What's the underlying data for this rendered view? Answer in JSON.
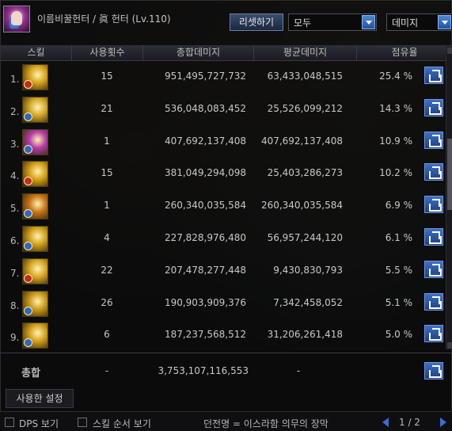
{
  "header": {
    "character_name": "이름비꿀헌터 / 眞 헌터 (Lv.110)",
    "reset_label": "리셋하기",
    "target_select": "모두",
    "sort_select": "데미지"
  },
  "columns": {
    "skill": "스킬",
    "count": "사용횟수",
    "total": "총합데미지",
    "avg": "평균데미지",
    "share": "점유율"
  },
  "rows": [
    {
      "idx": "1.",
      "count": "15",
      "total": "951,495,727,732",
      "avg": "63,433,048,515",
      "share": "25.4 %",
      "icon": "skill-icon",
      "color": "#d9a21b"
    },
    {
      "idx": "2.",
      "count": "21",
      "total": "536,048,083,452",
      "avg": "25,526,099,212",
      "share": "14.3 %",
      "icon": "skill-icon",
      "color": "#d4a82a"
    },
    {
      "idx": "3.",
      "count": "1",
      "total": "407,692,137,408",
      "avg": "407,692,137,408",
      "share": "10.9 %",
      "icon": "skill-icon",
      "color": "#b43ca8"
    },
    {
      "idx": "4.",
      "count": "15",
      "total": "381,049,294,098",
      "avg": "25,403,286,273",
      "share": "10.2 %",
      "icon": "skill-icon",
      "color": "#d5a014"
    },
    {
      "idx": "5.",
      "count": "1",
      "total": "260,340,035,584",
      "avg": "260,340,035,584",
      "share": "6.9 %",
      "icon": "skill-icon",
      "color": "#c9741a"
    },
    {
      "idx": "6.",
      "count": "4",
      "total": "227,828,976,480",
      "avg": "56,957,244,120",
      "share": "6.1 %",
      "icon": "skill-icon",
      "color": "#d1a11c"
    },
    {
      "idx": "7.",
      "count": "22",
      "total": "207,478,277,448",
      "avg": "9,430,830,793",
      "share": "5.5 %",
      "icon": "skill-icon",
      "color": "#d8a722"
    },
    {
      "idx": "8.",
      "count": "26",
      "total": "190,903,909,376",
      "avg": "7,342,458,052",
      "share": "5.1 %",
      "icon": "skill-icon",
      "color": "#c99a19"
    },
    {
      "idx": "9.",
      "count": "6",
      "total": "187,237,568,512",
      "avg": "31,206,261,418",
      "share": "5.0 %",
      "icon": "skill-icon",
      "color": "#d2a01a"
    }
  ],
  "total": {
    "label": "총합",
    "count": "-",
    "value": "3,753,107,116,553",
    "avg": "-"
  },
  "used_settings_label": "사용한 설정",
  "bottom": {
    "dps_label": "DPS 보기",
    "skill_order_label": "스킬 순서 보기",
    "notice": "던전명 = 이스라함 의무의 장막",
    "page": "1 / 2"
  }
}
